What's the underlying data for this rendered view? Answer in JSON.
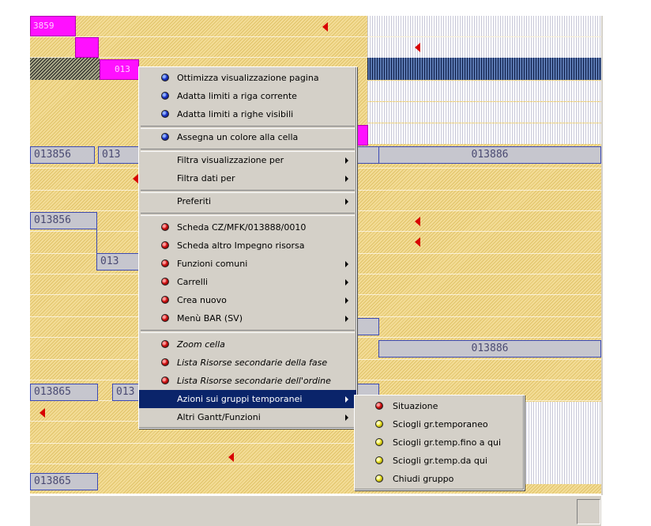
{
  "gantt": {
    "bar_labels": {
      "top_magenta": "3859",
      "dark_row_magenta": "013",
      "r1_left": "013856",
      "r1_second": "013",
      "r1_right": "013886",
      "r2_left": "013856",
      "r3_left": "013",
      "r4_right": "013886",
      "r5_left": "013865",
      "r5_second": "013",
      "r6_left": "013865"
    }
  },
  "context_menu": {
    "items": [
      {
        "label": "Ottimizza visualizzazione pagina",
        "icon": "blue-ball-icon"
      },
      {
        "label": "Adatta limiti a riga corrente",
        "icon": "blue-ball-icon"
      },
      {
        "label": "Adatta limiti a righe visibili",
        "icon": "blue-ball-icon"
      },
      {
        "label": "Assegna un colore alla cella",
        "icon": "blue-ball-icon"
      },
      {
        "label": "Filtra visualizzazione per",
        "submenu": true
      },
      {
        "label": "Filtra dati per",
        "submenu": true
      },
      {
        "label": "Preferiti",
        "submenu": true
      },
      {
        "label": "Scheda CZ/MFK/013888/0010",
        "icon": "red-ball-icon"
      },
      {
        "label": "Scheda altro Impegno risorsa",
        "icon": "red-ball-icon"
      },
      {
        "label": "Funzioni comuni",
        "icon": "red-ball-icon",
        "submenu": true
      },
      {
        "label": "Carrelli",
        "icon": "red-ball-icon",
        "submenu": true
      },
      {
        "label": "Crea nuovo",
        "icon": "red-ball-icon",
        "submenu": true
      },
      {
        "label": "Menù BAR (SV)",
        "icon": "red-ball-icon",
        "submenu": true
      },
      {
        "label": "Zoom cella",
        "icon": "red-ball-icon"
      },
      {
        "label": "Lista Risorse secondarie della fase",
        "icon": "red-ball-icon"
      },
      {
        "label": "Lista Risorse secondarie dell'ordine",
        "icon": "red-ball-icon"
      },
      {
        "label": "Azioni sui gruppi temporanei",
        "submenu": true,
        "selected": true
      },
      {
        "label": "Altri Gantt/Funzioni",
        "submenu": true
      }
    ]
  },
  "submenu": {
    "items": [
      {
        "label": "Situazione",
        "icon": "red-ball-icon"
      },
      {
        "label": "Sciogli gr.temporaneo",
        "icon": "yellow-ball-icon"
      },
      {
        "label": "Sciogli gr.temp.fino a qui",
        "icon": "yellow-ball-icon"
      },
      {
        "label": "Sciogli gr.temp.da qui",
        "icon": "yellow-ball-icon"
      },
      {
        "label": "Chiudi gruppo",
        "icon": "yellow-ball-icon"
      }
    ]
  },
  "colors": {
    "menu_bg": "#d4d0c8",
    "menu_highlight": "#0a246a",
    "gantt_bg": "#f3dc96",
    "magenta_bar": "#ff10ff",
    "gray_bar": "#c6c6ce"
  }
}
